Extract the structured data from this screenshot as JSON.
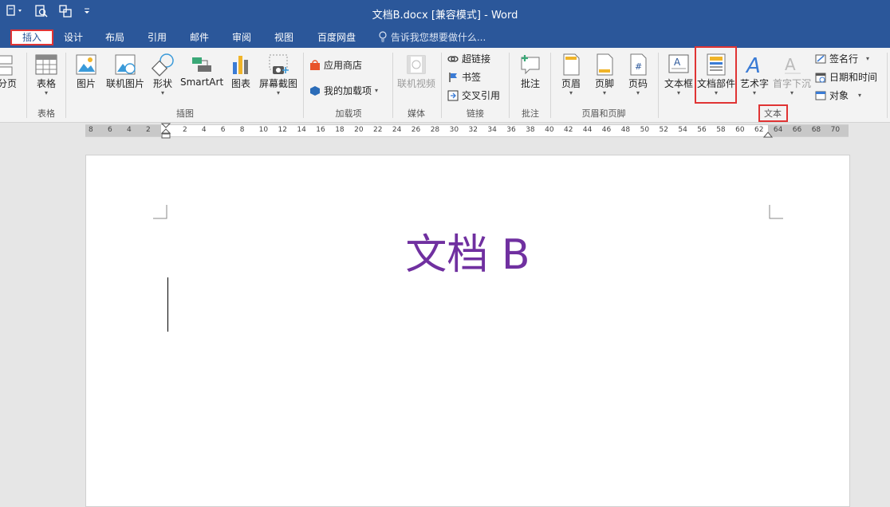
{
  "window": {
    "title": "文档B.docx [兼容模式] - Word"
  },
  "qat": {
    "items": [
      "save-dropdown",
      "print-preview",
      "touch-mode",
      "customize"
    ]
  },
  "tabs": [
    {
      "label": "插入",
      "active": true
    },
    {
      "label": "设计"
    },
    {
      "label": "布局"
    },
    {
      "label": "引用"
    },
    {
      "label": "邮件"
    },
    {
      "label": "审阅"
    },
    {
      "label": "视图"
    },
    {
      "label": "百度网盘"
    }
  ],
  "tellme": {
    "placeholder": "告诉我您想要做什么..."
  },
  "ribbon": {
    "pages": {
      "page_break": "分页"
    },
    "tables": {
      "table": "表格",
      "group": "表格"
    },
    "illustrations": {
      "picture": "图片",
      "online_picture": "联机图片",
      "shapes": "形状",
      "smartart": "SmartArt",
      "chart": "图表",
      "screenshot": "屏幕截图",
      "group": "插图"
    },
    "addins": {
      "store": "应用商店",
      "my_addins": "我的加载项",
      "group": "加载项"
    },
    "media": {
      "online_video": "联机视频",
      "group": "媒体"
    },
    "links": {
      "hyperlink": "超链接",
      "bookmark": "书签",
      "cross_ref": "交叉引用",
      "group": "链接"
    },
    "comments": {
      "comment": "批注",
      "group": "批注"
    },
    "header_footer": {
      "header": "页眉",
      "footer": "页脚",
      "page_number": "页码",
      "group": "页眉和页脚"
    },
    "text": {
      "textbox": "文本框",
      "quick_parts": "文档部件",
      "wordart": "艺术字",
      "dropcap": "首字下沉",
      "signature": "签名行",
      "datetime": "日期和时间",
      "object": "对象",
      "group": "文本"
    }
  },
  "ruler": {
    "ticks": [
      "8",
      "6",
      "4",
      "2",
      "2",
      "4",
      "6",
      "8",
      "10",
      "12",
      "14",
      "16",
      "18",
      "20",
      "22",
      "24",
      "26",
      "28",
      "30",
      "32",
      "34",
      "36",
      "38",
      "40",
      "42",
      "44",
      "46",
      "48",
      "50",
      "52",
      "54",
      "56",
      "58",
      "60",
      "62",
      "64",
      "66",
      "68",
      "70"
    ]
  },
  "document": {
    "heading": "文档 B"
  },
  "colors": {
    "accent": "#2b579a",
    "highlight": "#e03434",
    "heading": "#7030a0"
  }
}
